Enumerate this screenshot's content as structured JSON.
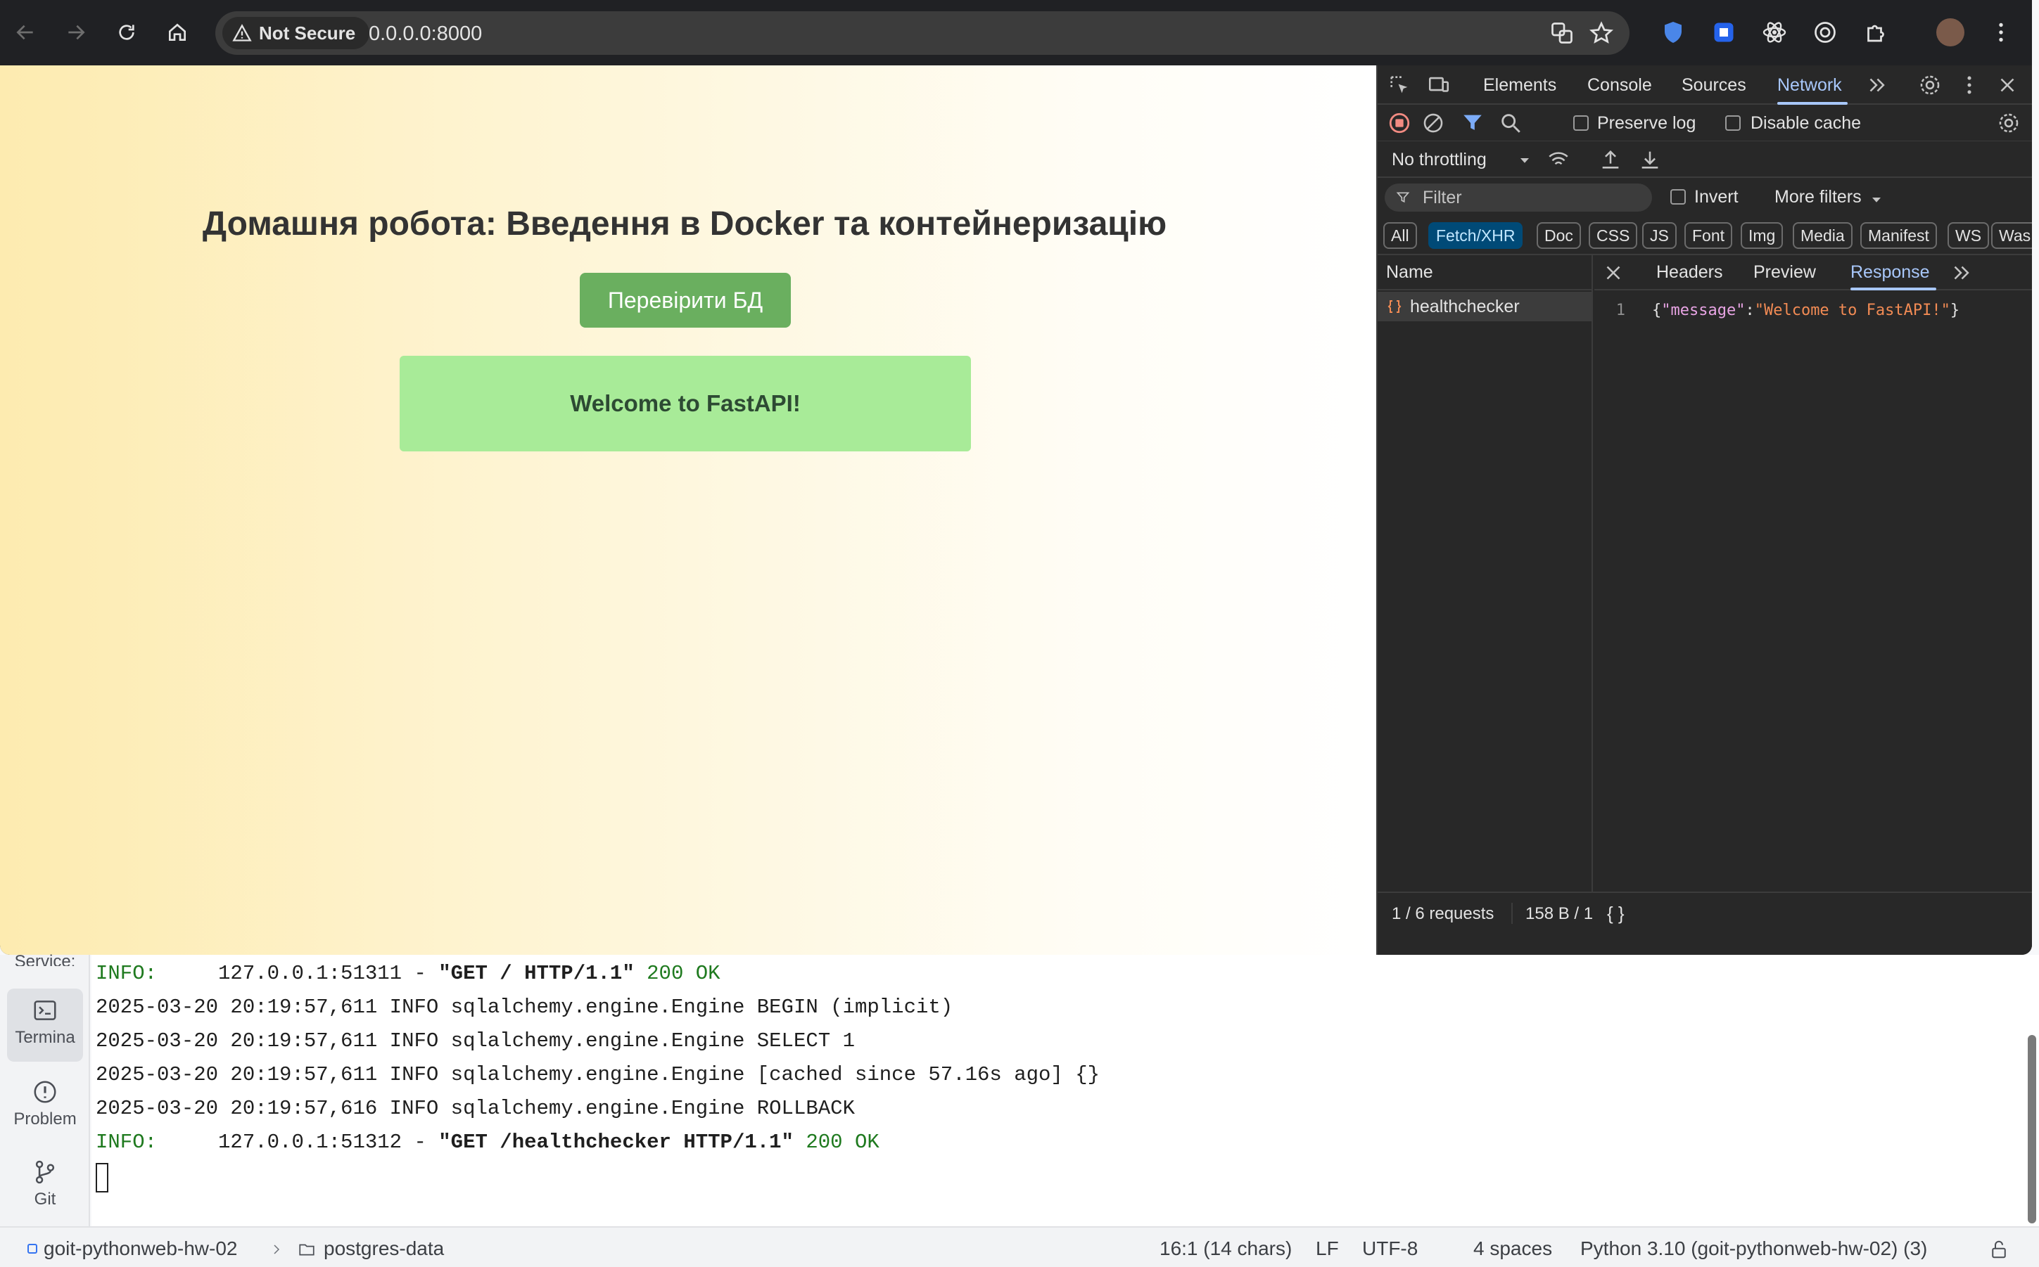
{
  "browser": {
    "security_label": "Not Secure",
    "url": "0.0.0.0:8000"
  },
  "page": {
    "title": "Домашня робота: Введення в Docker та контейнеризацію",
    "check_button": "Перевірити БД",
    "result": "Welcome to FastAPI!"
  },
  "devtools": {
    "tabs": [
      "Elements",
      "Console",
      "Sources",
      "Network"
    ],
    "active_tab": "Network",
    "preserve_log": "Preserve log",
    "disable_cache": "Disable cache",
    "throttling": "No throttling",
    "filter_placeholder": "Filter",
    "invert": "Invert",
    "more_filters": "More filters",
    "types": [
      "All",
      "Fetch/XHR",
      "Doc",
      "CSS",
      "JS",
      "Font",
      "Img",
      "Media",
      "Manifest",
      "WS",
      "Was"
    ],
    "active_type": "Fetch/XHR",
    "name_header": "Name",
    "request_name": "healthchecker",
    "detail_tabs": [
      "Headers",
      "Preview",
      "Response"
    ],
    "active_detail_tab": "Response",
    "response": {
      "line_number": "1",
      "key": "\"message\"",
      "value": "\"Welcome to FastAPI!\""
    },
    "status": {
      "requests": "1 / 6 requests",
      "transferred": "158 B / 1",
      "format_icon": "{ }"
    }
  },
  "ide": {
    "side": {
      "services": "Service:",
      "terminal": "Termina",
      "problems": "Problem",
      "git": "Git"
    },
    "terminal_lines": {
      "l1_level": "INFO:",
      "l1_text": "     127.0.0.1:51311 - ",
      "l1_request": "\"GET / HTTP/1.1\"",
      "l1_status": " 200 OK",
      "l2": "2025-03-20 20:19:57,611 INFO sqlalchemy.engine.Engine BEGIN (implicit)",
      "l3": "2025-03-20 20:19:57,611 INFO sqlalchemy.engine.Engine SELECT 1",
      "l4": "2025-03-20 20:19:57,611 INFO sqlalchemy.engine.Engine [cached since 57.16s ago] {}",
      "l5": "2025-03-20 20:19:57,616 INFO sqlalchemy.engine.Engine ROLLBACK",
      "l6_level": "INFO:",
      "l6_text": "     127.0.0.1:51312 - ",
      "l6_request": "\"GET /healthchecker HTTP/1.1\"",
      "l6_status": " 200 OK"
    },
    "status_bar": {
      "project": "goit-pythonweb-hw-02",
      "folder": "postgres-data",
      "position": "16:1 (14 chars)",
      "line_ending": "LF",
      "encoding": "UTF-8",
      "indent": "4 spaces",
      "interpreter": "Python 3.10 (goit-pythonweb-hw-02) (3)"
    }
  },
  "colors": {
    "button_green": "#6aaf5f",
    "result_green": "#a8eb98",
    "devtools_accent": "#a8c7fa",
    "record_red": "#f28b82"
  }
}
